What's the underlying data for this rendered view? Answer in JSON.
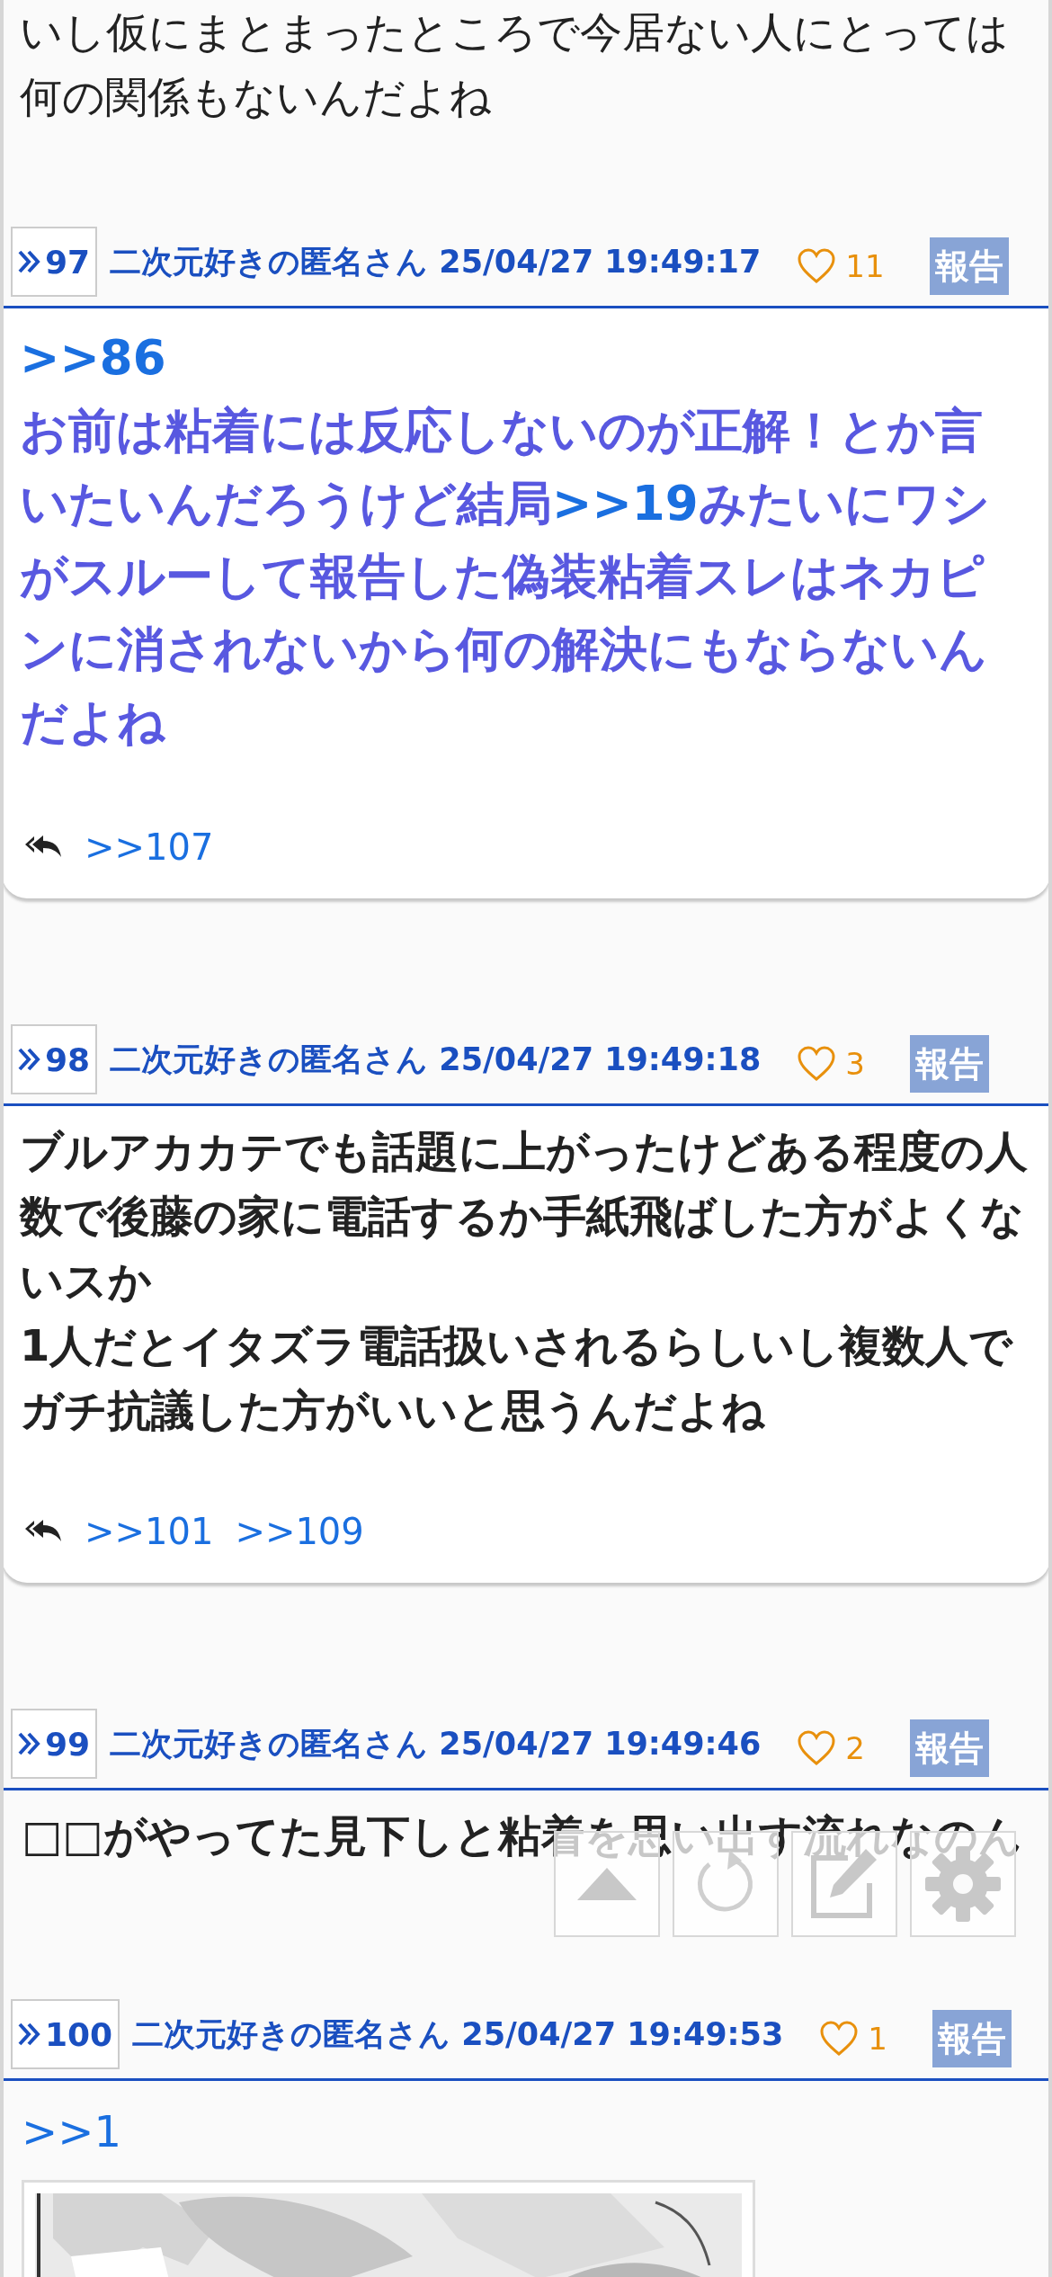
{
  "fragment": {
    "text": "いし仮にまとまったところで今居ない人にとっては何の関係もないんだよね"
  },
  "posts": [
    {
      "number": "97",
      "name": "二次元好きの匿名さん",
      "date": "25/04/27 19:49:17",
      "likes": "11",
      "report": "報告",
      "emphasized": true,
      "card": true,
      "body": [
        {
          "kind": "quote",
          "text": ">>86"
        },
        {
          "kind": "text",
          "text": "お前は粘着には反応しないのが正解！とか言いたいんだろうけど結局"
        },
        {
          "kind": "link",
          "text": ">>19"
        },
        {
          "kind": "text",
          "text": "みたいにワシがスルーして報告した偽装粘着スレはネカピンに消されないから何の解決にもならないんだよね"
        }
      ],
      "replies": [
        ">>107"
      ]
    },
    {
      "number": "98",
      "name": "二次元好きの匿名さん",
      "date": "25/04/27 19:49:18",
      "likes": "3",
      "report": "報告",
      "emphasized": false,
      "card": true,
      "body": [
        {
          "kind": "text",
          "text": "ブルアカカテでも話題に上がったけどある程度の人数で後藤の家に電話するか手紙飛ばした方がよくないスか\n1人だとイタズラ電話扱いされるらしいし複数人でガチ抗議した方がいいと思うんだよね"
        }
      ],
      "replies": [
        ">>101",
        ">>109"
      ]
    },
    {
      "number": "99",
      "name": "二次元好きの匿名さん",
      "date": "25/04/27 19:49:46",
      "likes": "2",
      "report": "報告",
      "emphasized": false,
      "card": false,
      "body": [
        {
          "kind": "text",
          "text": "□□がやってた見下しと粘着を思い出す流れなのん"
        }
      ]
    },
    {
      "number": "100",
      "name": "二次元好きの匿名さん",
      "date": "25/04/27 19:49:53",
      "likes": "1",
      "report": "報告",
      "emphasized": false,
      "card": false,
      "body": [
        {
          "kind": "quote_plain",
          "text": ">>1"
        },
        {
          "kind": "picture"
        }
      ]
    }
  ],
  "toolbar": [
    {
      "kind": "top"
    },
    {
      "kind": "reload"
    },
    {
      "kind": "write"
    },
    {
      "kind": "settings"
    }
  ]
}
